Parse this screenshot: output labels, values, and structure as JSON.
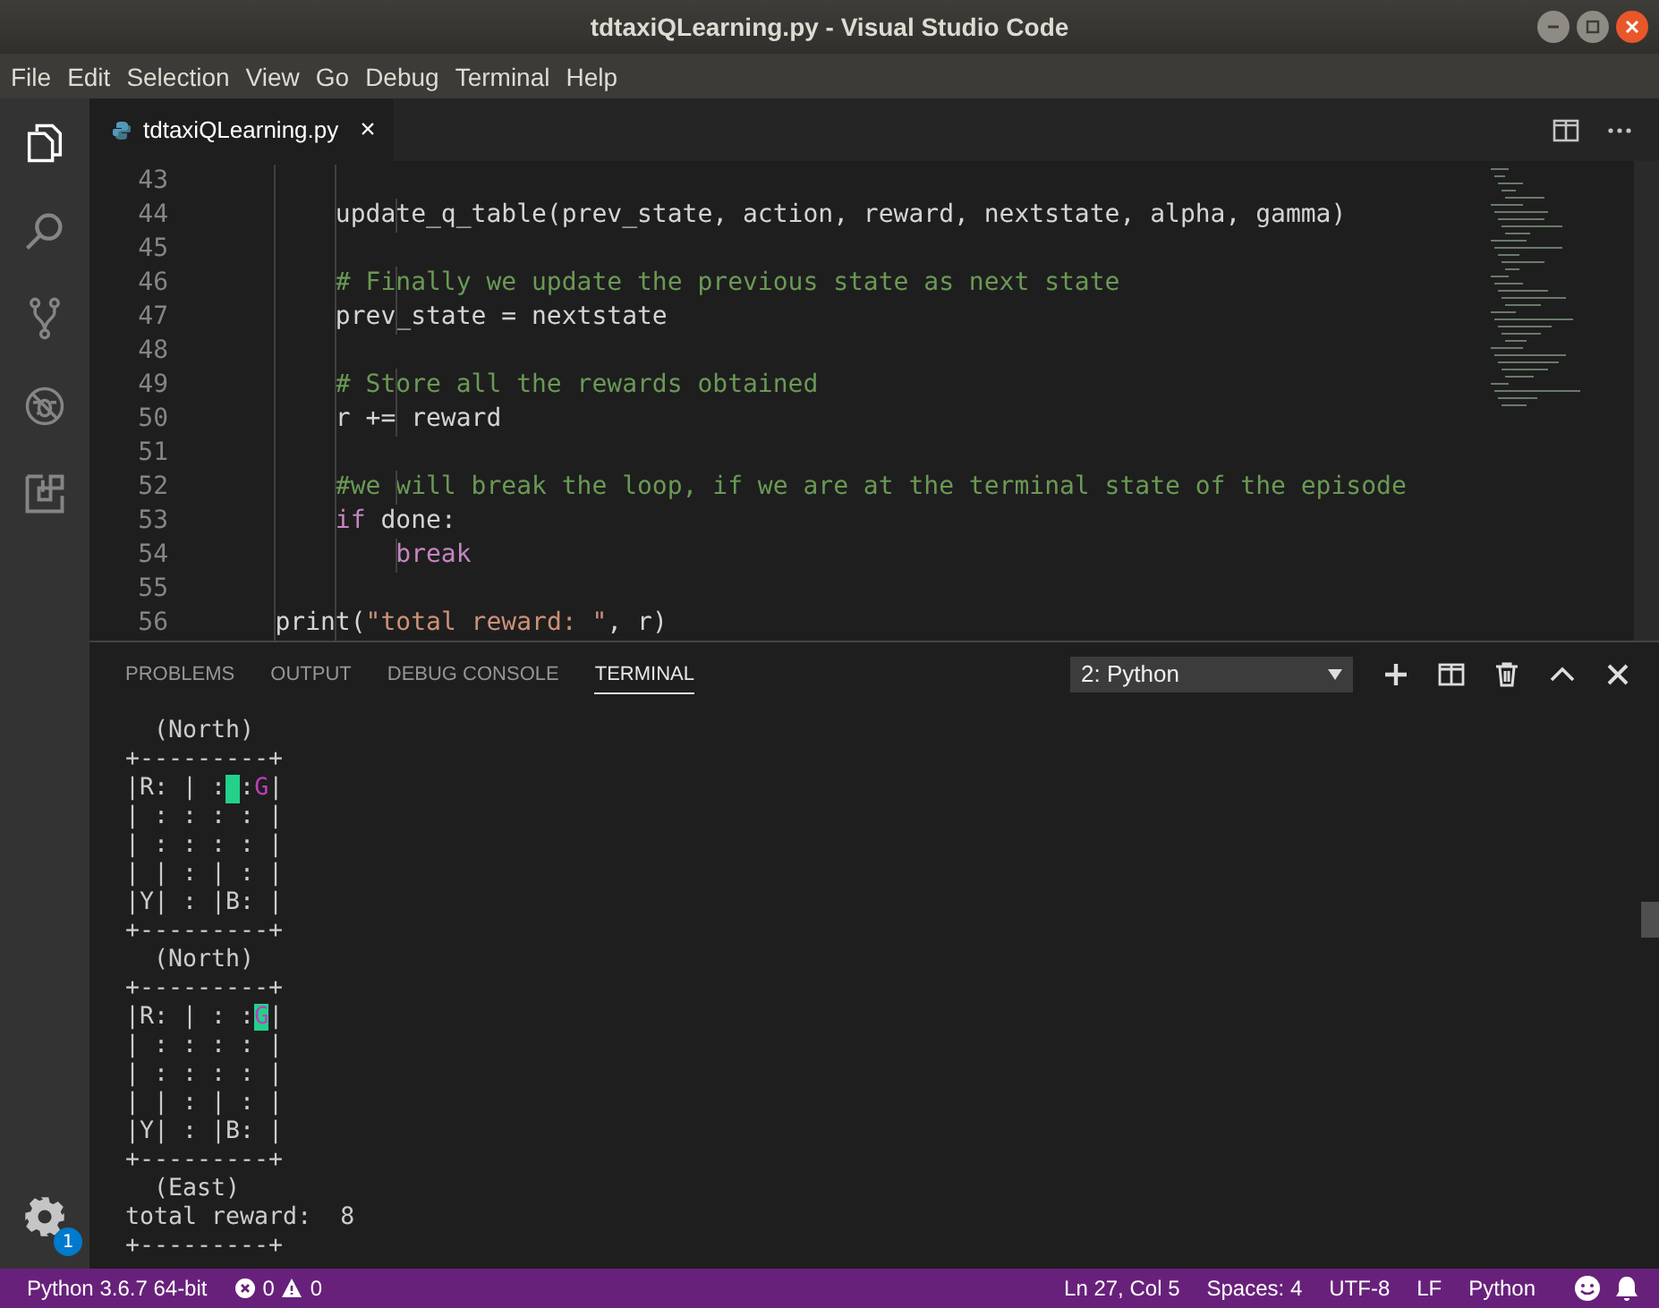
{
  "window": {
    "title": "tdtaxiQLearning.py - Visual Studio Code"
  },
  "menu": [
    "File",
    "Edit",
    "Selection",
    "View",
    "Go",
    "Debug",
    "Terminal",
    "Help"
  ],
  "activity_bar": {
    "items": [
      {
        "selected": true
      },
      {
        "selected": false
      },
      {
        "selected": false
      },
      {
        "selected": false
      },
      {
        "selected": false
      }
    ],
    "settings_badge": "1"
  },
  "editor": {
    "tabs": [
      {
        "label": "tdtaxiQLearning.py",
        "close": "×",
        "selected": true
      }
    ],
    "lines": [
      {
        "num": "43"
      },
      {
        "num": "44",
        "tokens": [
          {
            "text": "        update_q_table(prev_state, action, reward, nextstate, alpha, gamma)",
            "kind": "plain"
          }
        ]
      },
      {
        "num": "45"
      },
      {
        "num": "46",
        "tokens": [
          {
            "text": "        # Finally we update the previous state as next state",
            "kind": "comment"
          }
        ]
      },
      {
        "num": "47",
        "tokens": [
          {
            "text": "        prev_state = nextstate",
            "kind": "plain"
          }
        ]
      },
      {
        "num": "48"
      },
      {
        "num": "49",
        "tokens": [
          {
            "text": "        # Store all the rewards obtained",
            "kind": "comment"
          }
        ]
      },
      {
        "num": "50",
        "tokens": [
          {
            "text": "        r += reward",
            "kind": "plain"
          }
        ]
      },
      {
        "num": "51"
      },
      {
        "num": "52",
        "tokens": [
          {
            "text": "        #we will break the loop, if we are at the terminal state of the episode",
            "kind": "comment"
          }
        ]
      },
      {
        "num": "53",
        "tokens": [
          {
            "text": "        if",
            "kind": "keyword"
          },
          {
            "text": " done:",
            "kind": "plain"
          }
        ]
      },
      {
        "num": "54",
        "tokens": [
          {
            "text": "            break",
            "kind": "keyword"
          }
        ]
      },
      {
        "num": "55"
      },
      {
        "num": "56",
        "tokens": [
          {
            "text": "    print(",
            "kind": "plain"
          },
          {
            "text": "\"total reward: \"",
            "kind": "string"
          },
          {
            "text": ", r)",
            "kind": "plain"
          }
        ]
      }
    ]
  },
  "panel": {
    "tabs": [
      {
        "label": "PROBLEMS",
        "selected": false
      },
      {
        "label": "OUTPUT",
        "selected": false
      },
      {
        "label": "DEBUG CONSOLE",
        "selected": false
      },
      {
        "label": "TERMINAL",
        "selected": true
      }
    ],
    "terminal_select": "2: Python",
    "terminal": [
      [
        {
          "text": "  (North)",
          "kind": "plain"
        }
      ],
      [
        {
          "text": "+---------+",
          "kind": "plain"
        }
      ],
      [
        {
          "text": "|R: | :",
          "kind": "plain"
        },
        {
          "kind": "cursor"
        },
        {
          "text": ":",
          "kind": "plain"
        },
        {
          "text": "G",
          "kind": "dest"
        },
        {
          "text": "|",
          "kind": "plain"
        }
      ],
      [
        {
          "text": "| : : : : |",
          "kind": "plain"
        }
      ],
      [
        {
          "text": "| : : : : |",
          "kind": "plain"
        }
      ],
      [
        {
          "text": "| | : | : |",
          "kind": "plain"
        }
      ],
      [
        {
          "text": "|Y| : |B: |",
          "kind": "plain"
        }
      ],
      [
        {
          "text": "+---------+",
          "kind": "plain"
        }
      ],
      [
        {
          "text": "  (North)",
          "kind": "plain"
        }
      ],
      [
        {
          "text": "+---------+",
          "kind": "plain"
        }
      ],
      [
        {
          "text": "|R: | : :",
          "kind": "plain"
        },
        {
          "text": "G",
          "kind": "cursor-dest"
        },
        {
          "text": "|",
          "kind": "plain"
        }
      ],
      [
        {
          "text": "| : : : : |",
          "kind": "plain"
        }
      ],
      [
        {
          "text": "| : : : : |",
          "kind": "plain"
        }
      ],
      [
        {
          "text": "| | : | : |",
          "kind": "plain"
        }
      ],
      [
        {
          "text": "|Y| : |B: |",
          "kind": "plain"
        }
      ],
      [
        {
          "text": "+---------+",
          "kind": "plain"
        }
      ],
      [
        {
          "text": "  (East)",
          "kind": "plain"
        }
      ],
      [
        {
          "text": "total reward:  8",
          "kind": "plain"
        }
      ],
      [
        {
          "text": "+---------+",
          "kind": "plain"
        }
      ]
    ]
  },
  "status_bar": {
    "interpreter": "Python 3.6.7 64-bit",
    "errors": "0",
    "warnings": "0",
    "position": "Ln 27, Col 5",
    "spaces": "Spaces: 4",
    "encoding": "UTF-8",
    "eol": "LF",
    "language": "Python"
  }
}
